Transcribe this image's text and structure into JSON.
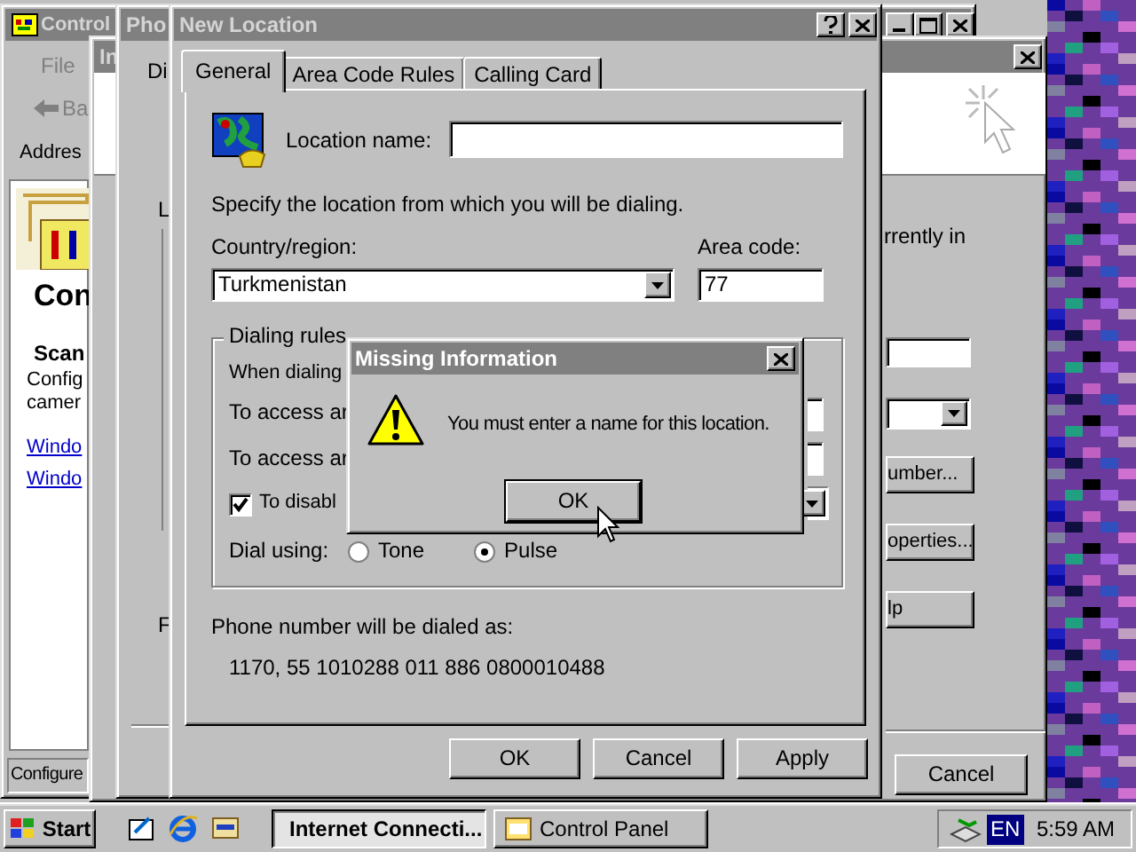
{
  "control_panel": {
    "title": "Control",
    "menu": "File",
    "back": "Ba",
    "address_label": "Addres",
    "heading": "Con",
    "item_title": "Scan",
    "item_lines": [
      "Config",
      "camer"
    ],
    "links": [
      "Windo",
      "Windo"
    ],
    "status_bar": "Configure"
  },
  "wizard_window": {
    "title": "In",
    "text": "rrently in",
    "buttons": [
      "umber...",
      "operties...",
      "lp"
    ],
    "cancel": "Cancel"
  },
  "phone_window": {
    "title": "Pho",
    "tab": "Di",
    "label_1": "L",
    "label_2": "F"
  },
  "new_location": {
    "title": "New Location",
    "tabs": [
      {
        "label": "General",
        "selected": true
      },
      {
        "label": "Area Code Rules",
        "selected": false
      },
      {
        "label": "Calling Card",
        "selected": false
      }
    ],
    "location_name_label": "Location name:",
    "instruction": "Specify the location from which you will be dialing.",
    "country_label": "Country/region:",
    "country": "Turkmenistan",
    "area_code_label": "Area code:",
    "area_code": "77",
    "dialing_rules": {
      "title": "Dialing rules",
      "rows": [
        "When dialing",
        "To access ar",
        "To access ar"
      ],
      "disable": {
        "label": "To disabl",
        "checked": true
      },
      "dial_using_label": "Dial using:",
      "dial_options": [
        {
          "label": "Tone",
          "selected": false
        },
        {
          "label": "Pulse",
          "selected": true
        }
      ]
    },
    "dialed_as_label": "Phone number will be dialed as:",
    "dialed_number": "1170, 55 1010288 011 886 0800010488",
    "buttons": [
      "OK",
      "Cancel",
      "Apply"
    ]
  },
  "message_box": {
    "title": "Missing Information",
    "message": "You must enter a name for this location.",
    "button": "OK"
  },
  "taskbar": {
    "start": "Start",
    "tasks": [
      {
        "label": "Internet Connecti...",
        "selected": true
      },
      {
        "label": "Control Panel",
        "selected": false
      }
    ],
    "language": "EN",
    "clock": "5:59 AM"
  }
}
